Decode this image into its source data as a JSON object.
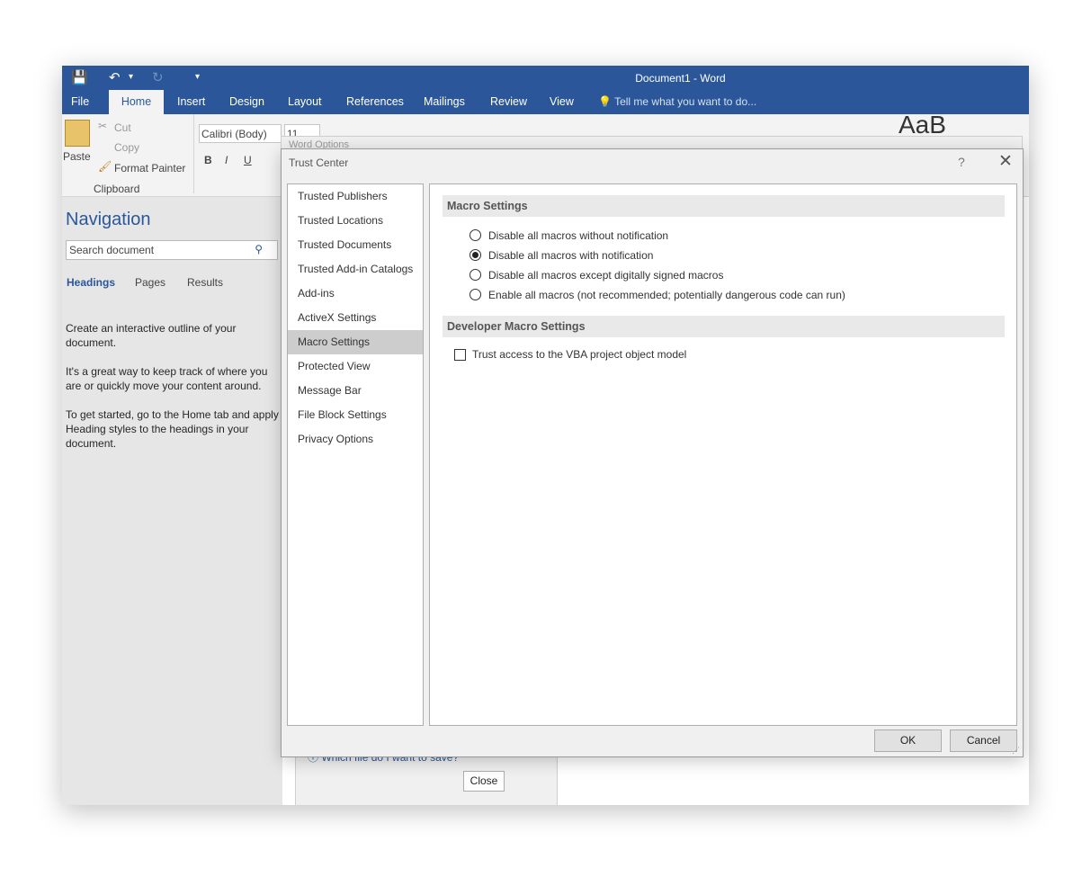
{
  "word": {
    "title": "Document1 - Word",
    "qat": {
      "save_glyph": "💾",
      "undo_glyph": "↶",
      "undo_dd": "▾",
      "redo_glyph": "↻",
      "customize_glyph": "▾"
    },
    "tabs": [
      "File",
      "Home",
      "Insert",
      "Design",
      "Layout",
      "References",
      "Mailings",
      "Review",
      "View"
    ],
    "active_tab": "Home",
    "tell_me": "Tell me what you want to do...",
    "ribbon": {
      "paste": "Paste",
      "cut": "Cut",
      "copy": "Copy",
      "format_painter": "Format Painter",
      "clipboard_group": "Clipboard",
      "font_name": "Calibri (Body)",
      "font_size": "11",
      "bold": "B",
      "italic": "I",
      "underline": "U",
      "styles_preview": "AaB"
    }
  },
  "navigation": {
    "title": "Navigation",
    "search_placeholder": "Search document",
    "tabs": [
      "Headings",
      "Pages",
      "Results"
    ],
    "para1": "Create an interactive outline of your document.",
    "para2": "It's a great way to keep track of where you are or quickly move your content around.",
    "para3": "To get started, go to the Home tab and apply Heading styles to the headings in your document."
  },
  "background_dialog": {
    "title": "Word Options",
    "help_link": "Which file do I want to save?",
    "close_button": "Close"
  },
  "trust_center": {
    "title": "Trust Center",
    "help": "?",
    "close": "✕",
    "categories": [
      "Trusted Publishers",
      "Trusted Locations",
      "Trusted Documents",
      "Trusted Add-in Catalogs",
      "Add-ins",
      "ActiveX Settings",
      "Macro Settings",
      "Protected View",
      "Message Bar",
      "File Block Settings",
      "Privacy Options"
    ],
    "selected_category": "Macro Settings",
    "macro_header": "Macro Settings",
    "macro_options": [
      "Disable all macros without notification",
      "Disable all macros with notification",
      "Disable all macros except digitally signed macros",
      "Enable all macros (not recommended; potentially dangerous code can run)"
    ],
    "selected_option_index": 1,
    "dev_header": "Developer Macro Settings",
    "vba_label": "Trust access to the VBA project object model",
    "vba_checked": false,
    "ok": "OK",
    "cancel": "Cancel"
  }
}
